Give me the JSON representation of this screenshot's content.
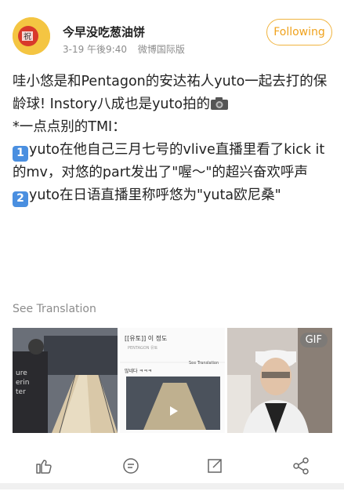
{
  "user": {
    "name": "今早没吃葱油饼"
  },
  "meta": {
    "time": "3-19 午後9:40",
    "source": "微博国际版"
  },
  "follow": {
    "label": "Following"
  },
  "post": {
    "line1": "哇小悠是和Pentagon的安达祐人yuto一起去打的保龄球! Instory八成也是yuto拍的",
    "line2": "*一点点别的TMI：",
    "item1_num": "1",
    "item1": "yuto在他自己三月七号的vlive直播里看了kick it的mv，对悠的part发出了\"喔～\"的超兴奋欢呼声",
    "item2_num": "2",
    "item2": "yuto在日语直播里称呼悠为\"yuta欧尼桑\""
  },
  "translation": {
    "label": "See Translation"
  },
  "media": {
    "screenshot": {
      "title": "[[유토]] 이 정도",
      "sub": "PENTAGON 유토",
      "translate": "See Translation",
      "caption": "많네다 ㅋㅋㅋ"
    },
    "gif_label": "GIF"
  },
  "icons": {
    "like": "thumbs-up-icon",
    "comment": "comment-icon",
    "repost": "repost-icon",
    "share": "share-icon"
  },
  "colors": {
    "accent": "#f0a21d",
    "number_badge": "#4a8fe0"
  }
}
